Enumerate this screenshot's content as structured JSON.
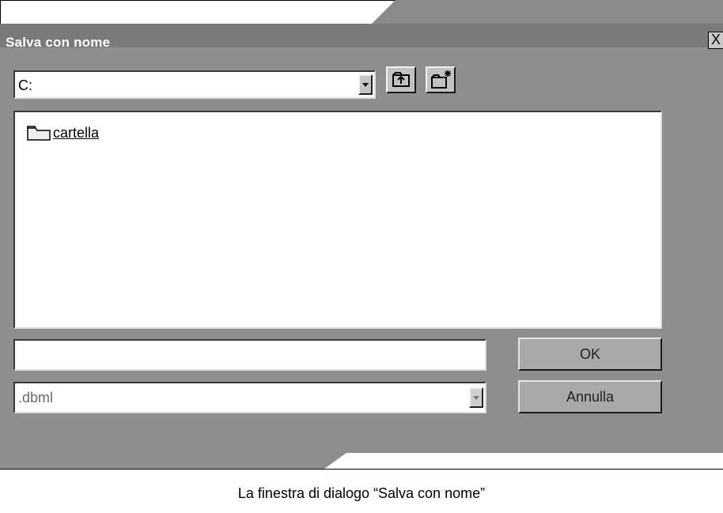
{
  "dialog": {
    "title": "Salva con nome",
    "close_label": "X",
    "drive": {
      "selected": "C:"
    },
    "toolbar": {
      "up_icon": "up-folder-icon",
      "new_folder_icon": "new-folder-icon"
    },
    "files": [
      {
        "label": "cartella",
        "icon": "folder-icon"
      }
    ],
    "filename": {
      "value": ""
    },
    "filetype": {
      "selected": ".dbml"
    },
    "buttons": {
      "ok": "OK",
      "cancel": "Annulla"
    }
  },
  "caption": "La finestra di dialogo “Salva con nome”",
  "colors": {
    "dialog_bg": "#8e8e8e",
    "titlebar": "#7a7a7a",
    "title_text": "#ffffff"
  }
}
